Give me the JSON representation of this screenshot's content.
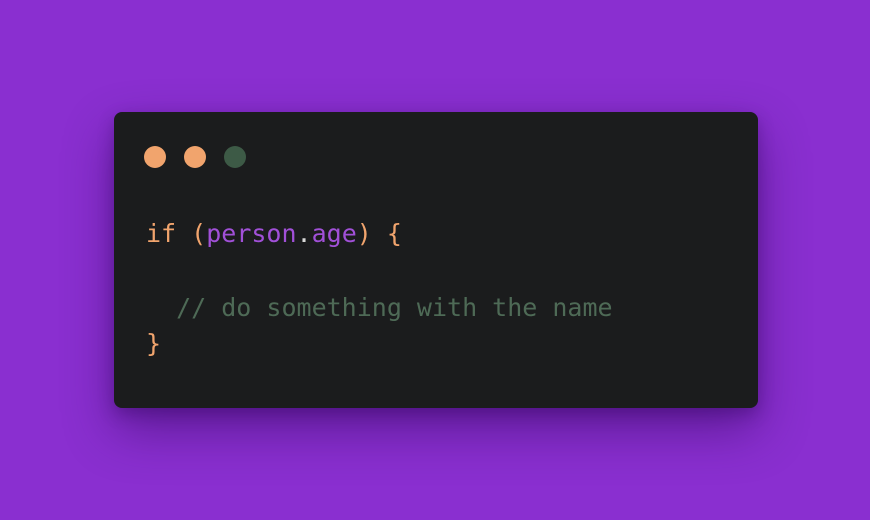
{
  "window": {
    "controls": [
      {
        "name": "close",
        "color": "#f1a46d"
      },
      {
        "name": "minimize",
        "color": "#f1a46d"
      },
      {
        "name": "maximize",
        "color": "#3d5a46"
      }
    ]
  },
  "code": {
    "line1": {
      "keyword": "if",
      "open_paren": " (",
      "object": "person",
      "dot": ".",
      "property": "age",
      "close": ") {"
    },
    "comment_line": "  // do something with the name",
    "closing_brace": "}"
  },
  "colors": {
    "background": "#8a2fd0",
    "panel": "#1b1c1d",
    "keyword": "#f1a46d",
    "identifier": "#a150d8",
    "comment": "#4e6a56"
  }
}
